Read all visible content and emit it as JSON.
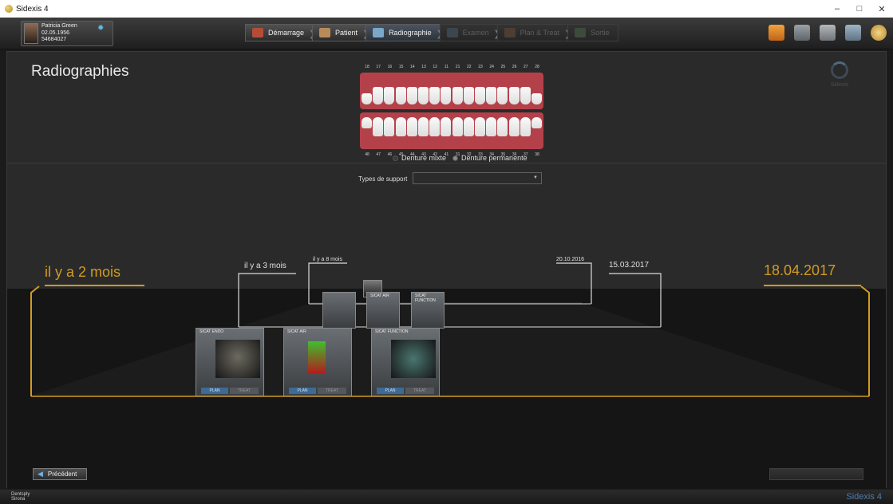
{
  "window": {
    "title": "Sidexis 4"
  },
  "patient": {
    "name": "Patricia Green",
    "birthdate": "02.05.1956",
    "id": "54684027"
  },
  "nav": {
    "steps": [
      {
        "label": "Démarrage",
        "state": "normal",
        "icon": "home-icon"
      },
      {
        "label": "Patient",
        "state": "normal",
        "icon": "patient-icon"
      },
      {
        "label": "Radiographie",
        "state": "active",
        "icon": "xray-icon"
      },
      {
        "label": "Examen",
        "state": "disabled",
        "icon": "exam-icon"
      },
      {
        "label": "Plan & Treat",
        "state": "disabled",
        "icon": "plan-icon"
      },
      {
        "label": "Sortie",
        "state": "disabled",
        "icon": "output-icon"
      }
    ]
  },
  "page": {
    "title": "Radiographies",
    "sidexis_label": "Sidexis"
  },
  "teeth": {
    "upper_numbers": [
      "18",
      "17",
      "16",
      "15",
      "14",
      "13",
      "12",
      "11",
      "21",
      "22",
      "23",
      "24",
      "25",
      "26",
      "27",
      "28"
    ],
    "lower_numbers": [
      "48",
      "47",
      "46",
      "45",
      "44",
      "43",
      "42",
      "41",
      "31",
      "32",
      "33",
      "34",
      "35",
      "36",
      "37",
      "38"
    ],
    "options": {
      "mixed": "Denture mixte",
      "permanent": "Denture permanente",
      "selected": "permanent"
    }
  },
  "filter": {
    "label": "Types de support",
    "value": ""
  },
  "timeline": {
    "left_date": "il y a 2 mois",
    "right_date": "18.04.2017",
    "dates": [
      "il y a 3 mois",
      "il y a 8 mois",
      "20.10.2016",
      "15.03.2017"
    ],
    "cards": [
      {
        "title": "SICAT ENDO",
        "plan": "PLAN",
        "treat": "TREAT"
      },
      {
        "title": "SICAT AIR",
        "plan": "PLAN",
        "treat": "TREAT"
      },
      {
        "title": "SICAT FUNCTION",
        "plan": "PLAN",
        "treat": "TREAT"
      }
    ],
    "back_cards": [
      {
        "title": ""
      },
      {
        "title": "SICAT AIR"
      },
      {
        "title": "SICAT FUNCTION"
      }
    ]
  },
  "buttons": {
    "previous": "Précédent"
  },
  "footer": {
    "logo_line1": "Dentsply",
    "logo_line2": "Sirona",
    "brand": "Sidexis 4"
  },
  "colors": {
    "accent": "#d29a22",
    "background": "#2a2a2a",
    "floor": "#151515",
    "gum": "#b4414a",
    "active_step": "#4a5460"
  }
}
